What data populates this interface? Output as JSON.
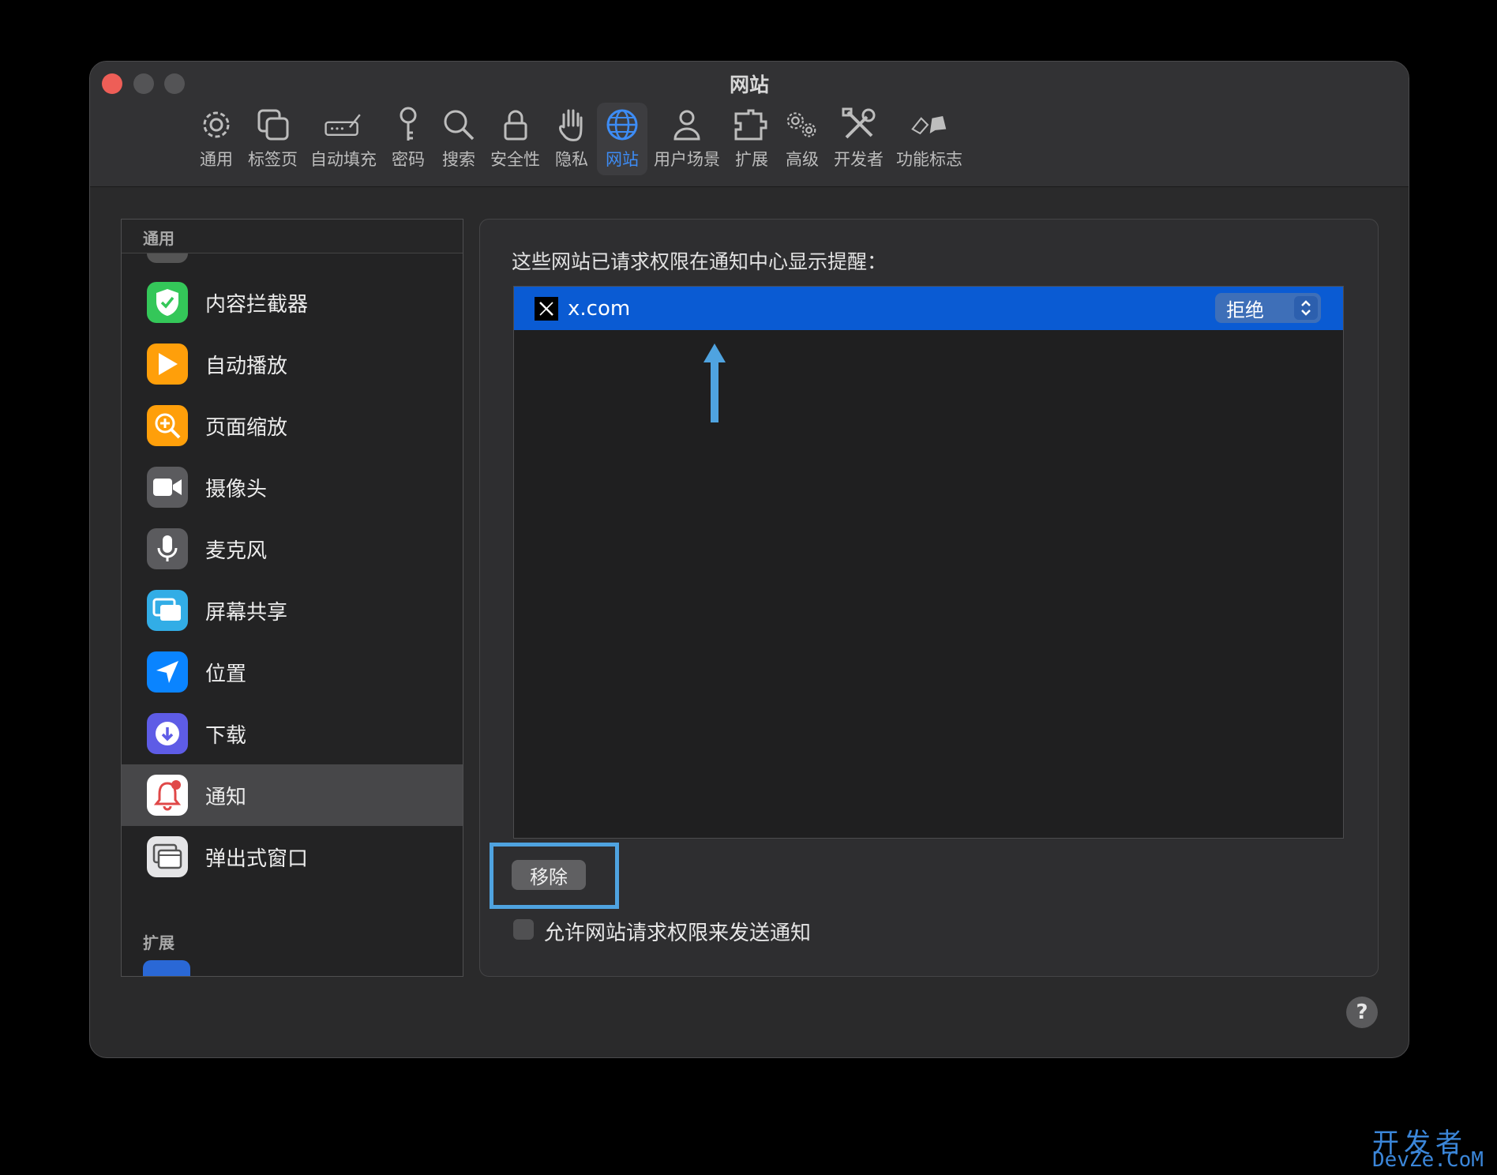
{
  "window": {
    "title": "网站"
  },
  "toolbar": {
    "items": [
      {
        "label": "通用",
        "icon": "gear-icon"
      },
      {
        "label": "标签页",
        "icon": "tabs-icon"
      },
      {
        "label": "自动填充",
        "icon": "autofill-icon"
      },
      {
        "label": "密码",
        "icon": "key-icon"
      },
      {
        "label": "搜索",
        "icon": "search-icon"
      },
      {
        "label": "安全性",
        "icon": "lock-icon"
      },
      {
        "label": "隐私",
        "icon": "hand-icon"
      },
      {
        "label": "网站",
        "icon": "globe-icon",
        "active": true
      },
      {
        "label": "用户场景",
        "icon": "person-icon"
      },
      {
        "label": "扩展",
        "icon": "puzzle-icon"
      },
      {
        "label": "高级",
        "icon": "gears-icon"
      },
      {
        "label": "开发者",
        "icon": "tools-icon"
      },
      {
        "label": "功能标志",
        "icon": "flags-icon"
      }
    ],
    "accent": "#3d8cf5"
  },
  "sidebar": {
    "section_general": "通用",
    "section_extensions": "扩展",
    "items": [
      {
        "label": "内容拦截器",
        "icon": "shield-check-icon",
        "color": "#34c759"
      },
      {
        "label": "自动播放",
        "icon": "play-icon",
        "color": "#ff9f0a"
      },
      {
        "label": "页面缩放",
        "icon": "zoom-icon",
        "color": "#ff9f0a"
      },
      {
        "label": "摄像头",
        "icon": "camera-icon",
        "color": "#5b5b5e"
      },
      {
        "label": "麦克风",
        "icon": "microphone-icon",
        "color": "#5b5b5e"
      },
      {
        "label": "屏幕共享",
        "icon": "screen-share-icon",
        "color": "#32ade6"
      },
      {
        "label": "位置",
        "icon": "location-icon",
        "color": "#0a84ff"
      },
      {
        "label": "下载",
        "icon": "download-icon",
        "color": "#5e5ce6"
      },
      {
        "label": "通知",
        "icon": "bell-icon",
        "color": "#ffffff",
        "selected": true
      },
      {
        "label": "弹出式窗口",
        "icon": "popup-window-icon",
        "color": "#e5e5e7"
      }
    ]
  },
  "panel": {
    "heading": "这些网站已请求权限在通知中心显示提醒：",
    "rows": [
      {
        "site": "x.com",
        "permission": "拒绝",
        "icon": "x-logo-icon"
      }
    ],
    "remove_label": "移除",
    "allow_label": "允许网站请求权限来发送通知",
    "allow_checked": false,
    "selection_color": "#0a5bd3"
  },
  "help_label": "?",
  "watermark": {
    "line1": "开发者",
    "line2": "DevZe.CoM"
  }
}
